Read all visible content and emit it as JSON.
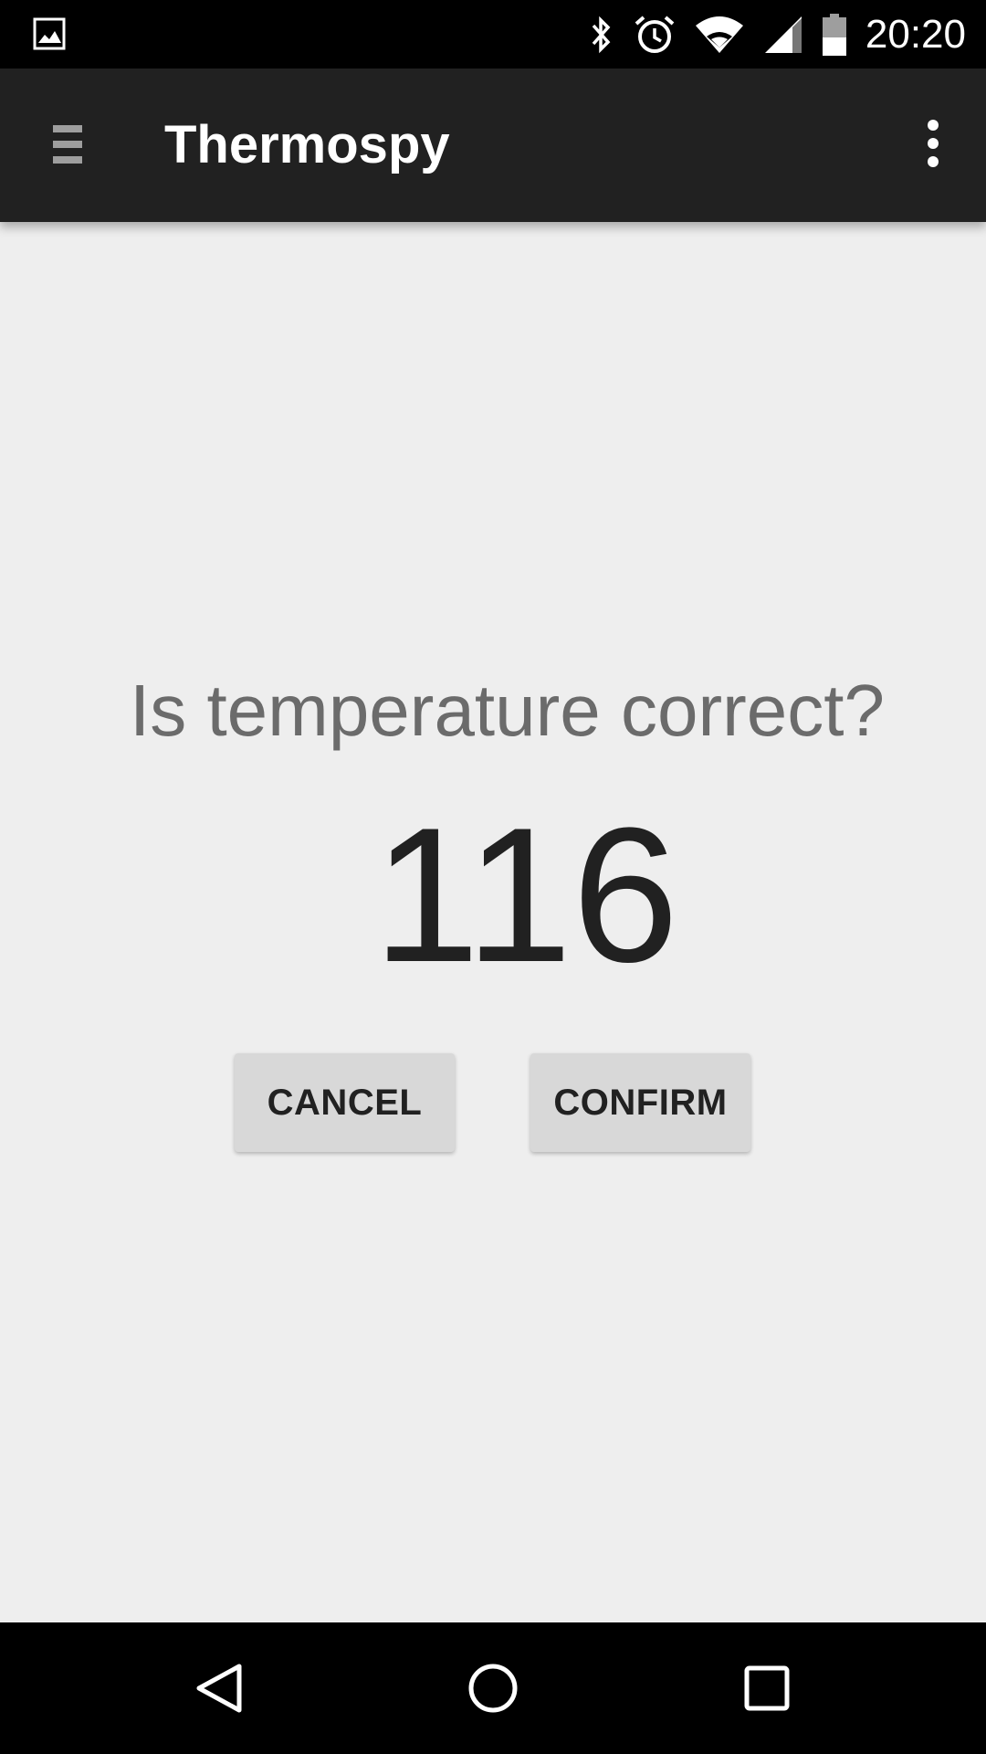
{
  "status_bar": {
    "time": "20:20",
    "icons": [
      "image-notification-icon",
      "bluetooth-icon",
      "alarm-icon",
      "wifi-icon",
      "cell-signal-icon",
      "battery-icon"
    ]
  },
  "app_bar": {
    "title": "Thermospy",
    "icons": [
      "menu-icon",
      "overflow-menu-icon"
    ]
  },
  "main": {
    "question": "Is temperature correct?",
    "temperature": "116",
    "cancel_label": "CANCEL",
    "confirm_label": "CONFIRM"
  },
  "nav_bar": {
    "icons": [
      "back-icon",
      "home-icon",
      "recents-icon"
    ]
  },
  "colors": {
    "status_bar_bg": "#000000",
    "app_bar_bg": "#212121",
    "content_bg": "#eeeeee",
    "question_text": "#6b6b6b",
    "temperature_text": "#212121",
    "button_bg": "#d8d8d8"
  }
}
